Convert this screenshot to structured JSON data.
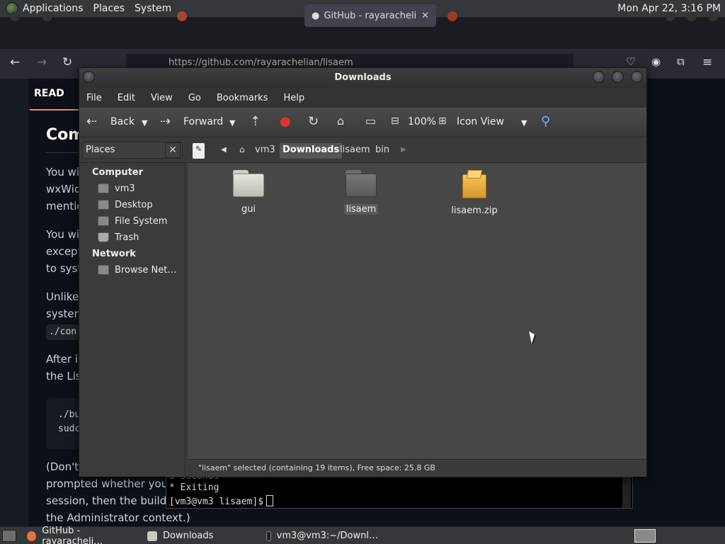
{
  "top_panel": {
    "menus": [
      "Applications",
      "Places",
      "System"
    ],
    "clock": "Mon Apr 22,  3:16 PM"
  },
  "browser": {
    "active_tab_label": "GitHub - rayarachelian",
    "url": "https://github.com/rayarachelian/lisaem"
  },
  "github_page": {
    "readme_label": "READ",
    "heading": "Com",
    "lines": [
      "You wi",
      "wxWid",
      "mentic",
      "You wi",
      "except",
      "to syst",
      "Unlike",
      "system",
      "After i",
      "the Lis",
      "(Don't",
      "prompted whether you w",
      "session, then the build w",
      "the Administrator context.)"
    ],
    "inline_code": "./con",
    "code_lines": [
      "./bu",
      "sudc"
    ]
  },
  "terminal": {
    "partial_line": "5 seconds",
    "line1": "* Exiting",
    "prompt": "[vm3@vm3 lisaem]$"
  },
  "file_manager": {
    "title": "Downloads",
    "menu": [
      "File",
      "Edit",
      "View",
      "Go",
      "Bookmarks",
      "Help"
    ],
    "toolbar": {
      "back": "Back",
      "forward": "Forward",
      "zoom": "100%",
      "view_mode": "Icon View"
    },
    "sidebar_selector": "Places",
    "breadcrumbs": [
      "vm3",
      "Downloads",
      "lisaem",
      "bin"
    ],
    "sidebar": {
      "computer_heading": "Computer",
      "computer_items": [
        "vm3",
        "Desktop",
        "File System",
        "Trash"
      ],
      "network_heading": "Network",
      "network_items": [
        "Browse Net…"
      ]
    },
    "files": [
      {
        "name": "gui",
        "type": "folder"
      },
      {
        "name": "lisaem",
        "type": "folder"
      },
      {
        "name": "lisaem.zip",
        "type": "archive"
      }
    ],
    "status": "\"lisaem\" selected (containing 19 items), Free space: 25.8 GB"
  },
  "taskbar": {
    "items": [
      "GitHub - rayaracheli…",
      "Downloads",
      "vm3@vm3:~/Downl…"
    ]
  }
}
